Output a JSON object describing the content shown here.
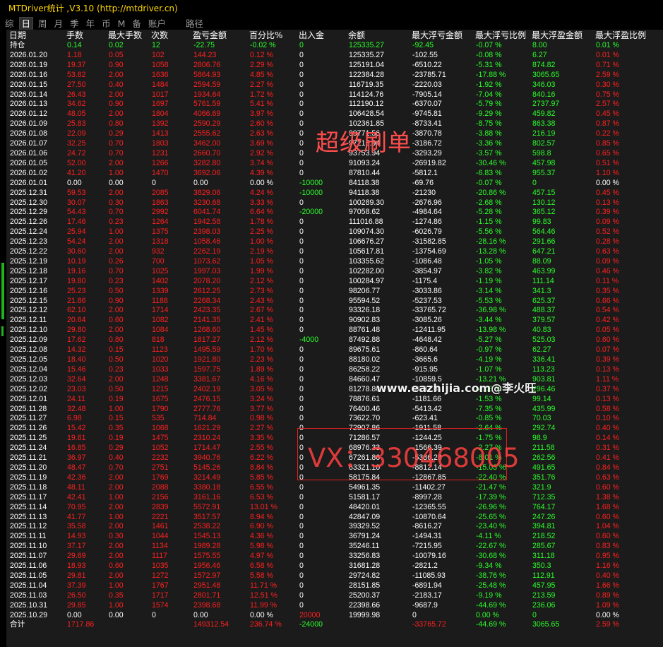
{
  "window": {
    "title": "MTDriver统计 ,V3.10 (http://mtdriver.cn)"
  },
  "tabs": [
    {
      "label": "综",
      "active": false
    },
    {
      "label": "日",
      "active": true
    },
    {
      "label": "周",
      "active": false
    },
    {
      "label": "月",
      "active": false
    },
    {
      "label": "季",
      "active": false
    },
    {
      "label": "年",
      "active": false
    },
    {
      "label": "币",
      "active": false
    },
    {
      "label": "M",
      "active": false
    },
    {
      "label": "备",
      "active": false
    },
    {
      "label": "账户",
      "active": false
    },
    {
      "label": "路径",
      "active": false
    }
  ],
  "columns": [
    "日期",
    "手数",
    "最大手数",
    "次数",
    "盈亏金额",
    "百分比%",
    "出入金",
    "余额",
    "最大浮亏金额",
    "最大浮亏比例",
    "最大浮盈金额",
    "最大浮盈比例"
  ],
  "hold_row": [
    "持仓",
    "0.14",
    "0.02",
    "12",
    "-22.75",
    "-0.02 %",
    "0",
    "125335.27",
    "-92.45",
    "-0.07 %",
    "8.00",
    "0.01 %"
  ],
  "rows": [
    [
      "2026.01.20",
      "1.18",
      "0.05",
      "102",
      "144.23",
      "0.12 %",
      "0",
      "125335.27",
      "-102.55",
      "-0.08 %",
      "6.27",
      "0.01 %"
    ],
    [
      "2026.01.19",
      "19.37",
      "0.90",
      "1058",
      "2806.76",
      "2.29 %",
      "0",
      "125191.04",
      "-6510.22",
      "-5.31 %",
      "874.82",
      "0.71 %"
    ],
    [
      "2026.01.16",
      "53.82",
      "2.00",
      "1636",
      "5864.93",
      "4.85 %",
      "0",
      "122384.28",
      "-23785.71",
      "-17.88 %",
      "3065.65",
      "2.59 %"
    ],
    [
      "2026.01.15",
      "27.50",
      "0.40",
      "1484",
      "2594.59",
      "2.27 %",
      "0",
      "116719.35",
      "-2220.03",
      "-1.92 %",
      "346.03",
      "0.30 %"
    ],
    [
      "2026.01.14",
      "26.43",
      "2.00",
      "1017",
      "1934.64",
      "1.72 %",
      "0",
      "114124.76",
      "-7905.14",
      "-7.04 %",
      "840.16",
      "0.75 %"
    ],
    [
      "2026.01.13",
      "34.62",
      "0.90",
      "1697",
      "5761.59",
      "5.41 %",
      "0",
      "112190.12",
      "-6370.07",
      "-5.79 %",
      "2737.97",
      "2.57 %"
    ],
    [
      "2026.01.12",
      "48.05",
      "2.00",
      "1804",
      "4066.69",
      "3.97 %",
      "0",
      "106428.54",
      "-9745.81",
      "-9.29 %",
      "459.82",
      "0.45 %"
    ],
    [
      "2026.01.09",
      "25.83",
      "0.80",
      "1392",
      "2590.29",
      "2.60 %",
      "0",
      "102361.85",
      "-8733.41",
      "-8.75 %",
      "863.38",
      "0.87 %"
    ],
    [
      "2026.01.08",
      "22.09",
      "0.29",
      "1413",
      "2555.62",
      "2.63 %",
      "0",
      "99771.56",
      "-3870.78",
      "-3.88 %",
      "216.19",
      "0.22 %"
    ],
    [
      "2026.01.07",
      "32.25",
      "0.70",
      "1803",
      "3462.00",
      "3.69 %",
      "0",
      "97215.94",
      "-3186.72",
      "-3.36 %",
      "802.57",
      "0.85 %"
    ],
    [
      "2026.01.06",
      "24.72",
      "0.70",
      "1231",
      "2660.70",
      "2.92 %",
      "0",
      "93753.94",
      "-3293.29",
      "-3.57 %",
      "598.8",
      "0.65 %"
    ],
    [
      "2026.01.05",
      "52.00",
      "2.00",
      "1266",
      "3282.80",
      "3.74 %",
      "0",
      "91093.24",
      "-26919.82",
      "-30.46 %",
      "457.98",
      "0.51 %"
    ],
    [
      "2026.01.02",
      "41.20",
      "1.00",
      "1470",
      "3692.06",
      "4.39 %",
      "0",
      "87810.44",
      "-5812.1",
      "-6.83 %",
      "955.37",
      "1.10 %"
    ],
    [
      "2026.01.01",
      "0.00",
      "0.00",
      "0",
      "0.00",
      "0.00 %",
      "-10000",
      "84118.38",
      "-69.76",
      "-0.07 %",
      "0",
      "0.00 %"
    ],
    [
      "2025.12.31",
      "59.53",
      "2.00",
      "2085",
      "3829.06",
      "4.24 %",
      "-10000",
      "94118.38",
      "-21230",
      "-20.86 %",
      "457.15",
      "0.45 %"
    ],
    [
      "2025.12.30",
      "30.07",
      "0.30",
      "1863",
      "3230.68",
      "3.33 %",
      "0",
      "100289.30",
      "-2676.96",
      "-2.68 %",
      "130.12",
      "0.13 %"
    ],
    [
      "2025.12.29",
      "54.43",
      "0.70",
      "2992",
      "6041.74",
      "6.64 %",
      "-20000",
      "97058.62",
      "-4984.64",
      "-5.28 %",
      "365.12",
      "0.39 %"
    ],
    [
      "2025.12.26",
      "17.46",
      "0.23",
      "1264",
      "1942.58",
      "1.78 %",
      "0",
      "111016.88",
      "-1274.86",
      "-1.15 %",
      "99.83",
      "0.09 %"
    ],
    [
      "2025.12.24",
      "25.94",
      "1.00",
      "1375",
      "2398.03",
      "2.25 %",
      "0",
      "109074.30",
      "-6026.79",
      "-5.56 %",
      "564.46",
      "0.52 %"
    ],
    [
      "2025.12.23",
      "54.24",
      "2.00",
      "1318",
      "1058.46",
      "1.00 %",
      "0",
      "106676.27",
      "-31582.85",
      "-28.16 %",
      "291.66",
      "0.28 %"
    ],
    [
      "2025.12.22",
      "30.60",
      "2.00",
      "932",
      "2262.19",
      "2.19 %",
      "0",
      "105617.81",
      "-13754.69",
      "-13.28 %",
      "647.21",
      "0.63 %"
    ],
    [
      "2025.12.19",
      "10.19",
      "0.26",
      "700",
      "1073.62",
      "1.05 %",
      "0",
      "103355.62",
      "-1086.48",
      "-1.05 %",
      "88.09",
      "0.09 %"
    ],
    [
      "2025.12.18",
      "19.16",
      "0.70",
      "1025",
      "1997.03",
      "1.99 %",
      "0",
      "102282.00",
      "-3854.97",
      "-3.82 %",
      "463.99",
      "0.46 %"
    ],
    [
      "2025.12.17",
      "19.80",
      "0.23",
      "1402",
      "2078.20",
      "2.12 %",
      "0",
      "100284.97",
      "-1175.4",
      "-1.19 %",
      "111.14",
      "0.11 %"
    ],
    [
      "2025.12.16",
      "25.23",
      "0.50",
      "1339",
      "2612.25",
      "2.73 %",
      "0",
      "98206.77",
      "-3033.86",
      "-3.14 %",
      "341.3",
      "0.35 %"
    ],
    [
      "2025.12.15",
      "21.86",
      "0.90",
      "1188",
      "2268.34",
      "2.43 %",
      "0",
      "95594.52",
      "-5237.53",
      "-5.53 %",
      "625.37",
      "0.66 %"
    ],
    [
      "2025.12.12",
      "62.10",
      "2.00",
      "1714",
      "2423.35",
      "2.67 %",
      "0",
      "93326.18",
      "-33765.72",
      "-36.98 %",
      "488.37",
      "0.54 %"
    ],
    [
      "2025.12.11",
      "20.64",
      "0.60",
      "1082",
      "2141.35",
      "2.41 %",
      "0",
      "90902.83",
      "-3085.26",
      "-3.44 %",
      "379.57",
      "0.42 %"
    ],
    [
      "2025.12.10",
      "29.80",
      "2.00",
      "1084",
      "1268.60",
      "1.45 %",
      "0",
      "88761.48",
      "-12411.95",
      "-13.98 %",
      "40.83",
      "0.05 %"
    ],
    [
      "2025.12.09",
      "17.62",
      "0.80",
      "818",
      "1817.27",
      "2.12 %",
      "-4000",
      "87492.88",
      "-4648.42",
      "-5.27 %",
      "525.03",
      "0.60 %"
    ],
    [
      "2025.12.08",
      "14.32",
      "0.15",
      "1123",
      "1495.59",
      "1.70 %",
      "0",
      "89675.61",
      "-860.64",
      "-0.97 %",
      "62.27",
      "0.07 %"
    ],
    [
      "2025.12.05",
      "18.40",
      "0.50",
      "1020",
      "1921.80",
      "2.23 %",
      "0",
      "88180.02",
      "-3665.6",
      "-4.19 %",
      "336.41",
      "0.39 %"
    ],
    [
      "2025.12.04",
      "15.46",
      "0.23",
      "1033",
      "1597.75",
      "1.89 %",
      "0",
      "86258.22",
      "-915.95",
      "-1.07 %",
      "113.23",
      "0.13 %"
    ],
    [
      "2025.12.03",
      "32.64",
      "2.00",
      "1248",
      "3381.67",
      "4.16 %",
      "0",
      "84660.47",
      "-10859.5",
      "-13.21 %",
      "903.81",
      "1.11 %"
    ],
    [
      "2025.12.02",
      "23.03",
      "0.50",
      "1215",
      "2402.19",
      "3.05 %",
      "0",
      "81278.80",
      "-3281.8",
      "-4.08 %",
      "296.46",
      "0.37 %"
    ],
    [
      "2025.12.01",
      "24.11",
      "0.19",
      "1675",
      "2476.15",
      "3.24 %",
      "0",
      "78876.61",
      "-1181.66",
      "-1.53 %",
      "99.14",
      "0.13 %"
    ],
    [
      "2025.11.28",
      "32.48",
      "1.00",
      "1790",
      "2777.76",
      "3.77 %",
      "0",
      "76400.46",
      "-5413.42",
      "-7.35 %",
      "435.99",
      "0.58 %"
    ],
    [
      "2025.11.27",
      "6.98",
      "0.15",
      "535",
      "714.84",
      "0.98 %",
      "0",
      "73622.70",
      "-623.41",
      "-0.85 %",
      "70.03",
      "0.10 %"
    ],
    [
      "2025.11.26",
      "15.42",
      "0.35",
      "1068",
      "1621.29",
      "2.27 %",
      "0",
      "72907.86",
      "-1911.58",
      "-2.64 %",
      "292.74",
      "0.40 %"
    ],
    [
      "2025.11.25",
      "19.61",
      "0.19",
      "1475",
      "2310.24",
      "3.35 %",
      "0",
      "71286.57",
      "-1244.25",
      "-1.75 %",
      "98.9",
      "0.14 %"
    ],
    [
      "2025.11.24",
      "16.85",
      "0.29",
      "1052",
      "1714.47",
      "2.55 %",
      "0",
      "68976.33",
      "-1566.39",
      "-2.27 %",
      "211.58",
      "0.31 %"
    ],
    [
      "2025.11.21",
      "36.97",
      "0.40",
      "2232",
      "3940.76",
      "6.22 %",
      "0",
      "67261.86",
      "-5386.28",
      "-8.01 %",
      "262.56",
      "0.41 %"
    ],
    [
      "2025.11.20",
      "48.47",
      "0.70",
      "2751",
      "5145.26",
      "8.84 %",
      "0",
      "63321.10",
      "-8812.14",
      "-15.03 %",
      "491.65",
      "0.84 %"
    ],
    [
      "2025.11.19",
      "42.36",
      "2.00",
      "1769",
      "3214.49",
      "5.85 %",
      "0",
      "58175.84",
      "-12867.85",
      "-22.40 %",
      "351.76",
      "0.63 %"
    ],
    [
      "2025.11.18",
      "48.11",
      "2.00",
      "2088",
      "3380.18",
      "6.55 %",
      "0",
      "54961.35",
      "-11402.27",
      "-21.47 %",
      "321.9",
      "0.60 %"
    ],
    [
      "2025.11.17",
      "42.41",
      "1.00",
      "2156",
      "3161.16",
      "6.53 %",
      "0",
      "51581.17",
      "-8997.28",
      "-17.39 %",
      "712.35",
      "1.38 %"
    ],
    [
      "2025.11.14",
      "70.95",
      "2.00",
      "2839",
      "5572.91",
      "13.01 %",
      "0",
      "48420.01",
      "-12365.55",
      "-26.96 %",
      "764.17",
      "1.68 %"
    ],
    [
      "2025.11.13",
      "41.77",
      "1.00",
      "2221",
      "3517.57",
      "8.94 %",
      "0",
      "42847.09",
      "-10870.64",
      "-25.65 %",
      "247.26",
      "0.60 %"
    ],
    [
      "2025.11.12",
      "35.58",
      "2.00",
      "1461",
      "2538.22",
      "6.90 %",
      "0",
      "39329.52",
      "-8616.27",
      "-23.40 %",
      "394.81",
      "1.04 %"
    ],
    [
      "2025.11.11",
      "14.93",
      "0.30",
      "1044",
      "1545.13",
      "4.36 %",
      "0",
      "36791.24",
      "-1494.31",
      "-4.11 %",
      "218.52",
      "0.60 %"
    ],
    [
      "2025.11.10",
      "37.17",
      "2.00",
      "1134",
      "1989.28",
      "5.98 %",
      "0",
      "35246.11",
      "-7215.95",
      "-22.67 %",
      "285.67",
      "0.83 %"
    ],
    [
      "2025.11.07",
      "29.69",
      "2.00",
      "1117",
      "1575.55",
      "4.97 %",
      "0",
      "33256.83",
      "-10079.16",
      "-30.68 %",
      "311.18",
      "0.95 %"
    ],
    [
      "2025.11.06",
      "18.93",
      "0.60",
      "1035",
      "1956.46",
      "6.58 %",
      "0",
      "31681.28",
      "-2821.2",
      "-9.34 %",
      "350.3",
      "1.16 %"
    ],
    [
      "2025.11.05",
      "29.81",
      "2.00",
      "1272",
      "1572.97",
      "5.58 %",
      "0",
      "29724.82",
      "-11085.93",
      "-38.76 %",
      "112.91",
      "0.40 %"
    ],
    [
      "2025.11.04",
      "37.39",
      "1.00",
      "1767",
      "2951.48",
      "11.71 %",
      "0",
      "28151.85",
      "-6891.94",
      "-25.48 %",
      "457.95",
      "1.66 %"
    ],
    [
      "2025.11.03",
      "26.50",
      "0.35",
      "1717",
      "2801.71",
      "12.51 %",
      "0",
      "25200.37",
      "-2183.17",
      "-9.19 %",
      "213.59",
      "0.89 %"
    ],
    [
      "2025.10.31",
      "29.85",
      "1.00",
      "1574",
      "2398.68",
      "11.99 %",
      "0",
      "22398.66",
      "-9687.9",
      "-44.69 %",
      "236.06",
      "1.09 %"
    ],
    [
      "2025.10.29",
      "0.00",
      "0.00",
      "0",
      "0.00",
      "0.00 %",
      "20000",
      "19999.98",
      "0",
      "0.00 %",
      "0",
      "0.00 %"
    ]
  ],
  "total_row": [
    "合计",
    "1717.86",
    "",
    "",
    "149312.54",
    "236.74 %",
    "-24000",
    "",
    "-33765.72",
    "-44.69 %",
    "3065.65",
    "2.59 %"
  ],
  "watermarks": {
    "text1": "超级刷单",
    "text2": "www.eazhijia.com@李火旺",
    "text3": "VX：330468005"
  },
  "colors": {
    "positive": "#ff2020",
    "negative": "#2aff2a",
    "text": "#ffffff",
    "title": "#ffd700",
    "background": "#1b1b1b"
  }
}
